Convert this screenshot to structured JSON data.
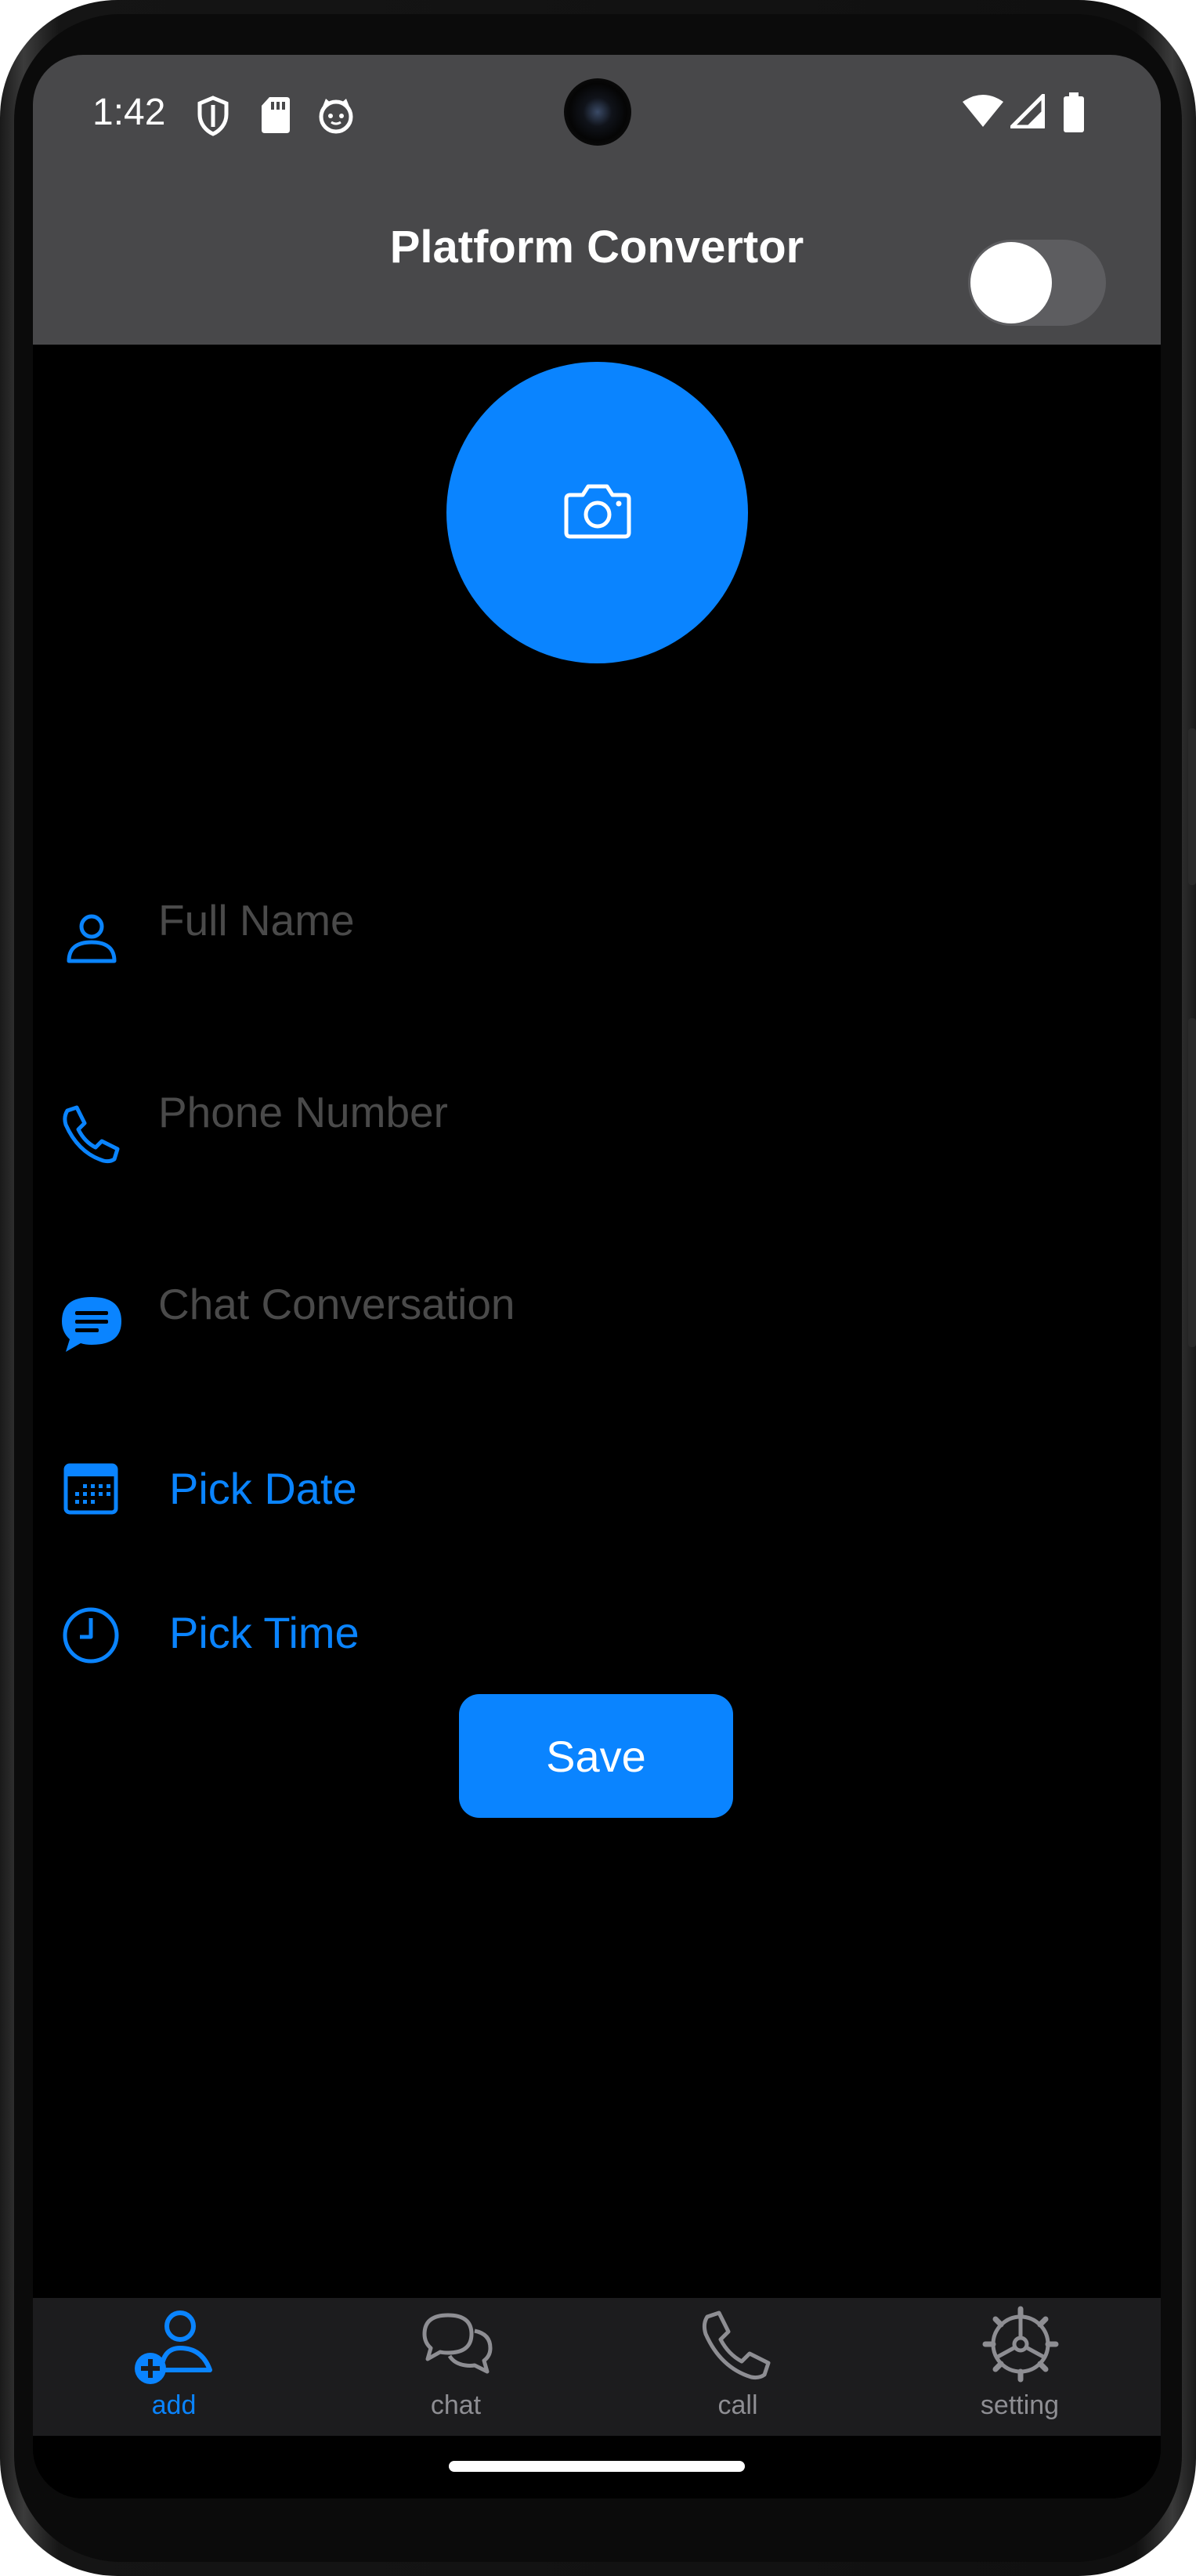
{
  "status_bar": {
    "time": "1:42",
    "left_icons": [
      "shield-icon",
      "sd-card-icon",
      "cat-face-icon"
    ],
    "right_icons": [
      "wifi-icon",
      "signal-icon",
      "battery-icon"
    ]
  },
  "app_bar": {
    "title": "Platform Convertor",
    "toggle_on": false
  },
  "avatar": {
    "icon": "camera-icon"
  },
  "form": {
    "full_name": {
      "placeholder": "Full Name",
      "value": "",
      "icon": "person-icon"
    },
    "phone": {
      "placeholder": "Phone Number",
      "value": "",
      "icon": "phone-icon"
    },
    "chat": {
      "placeholder": "Chat Conversation",
      "value": "",
      "icon": "chat-bubble-icon"
    },
    "pick_date": {
      "label": "Pick Date",
      "icon": "calendar-icon"
    },
    "pick_time": {
      "label": "Pick Time",
      "icon": "clock-icon"
    },
    "save_label": "Save"
  },
  "bottom_nav": {
    "items": [
      {
        "label": "add",
        "icon": "add-person-icon",
        "active": true
      },
      {
        "label": "chat",
        "icon": "chat-icon",
        "active": false
      },
      {
        "label": "call",
        "icon": "phone-icon",
        "active": false
      },
      {
        "label": "setting",
        "icon": "gear-icon",
        "active": false
      }
    ]
  },
  "colors": {
    "accent": "#0a84ff",
    "bar": "#48484a",
    "background": "#000000",
    "inactive": "#8e8e93",
    "placeholder": "#4a4a4a"
  }
}
